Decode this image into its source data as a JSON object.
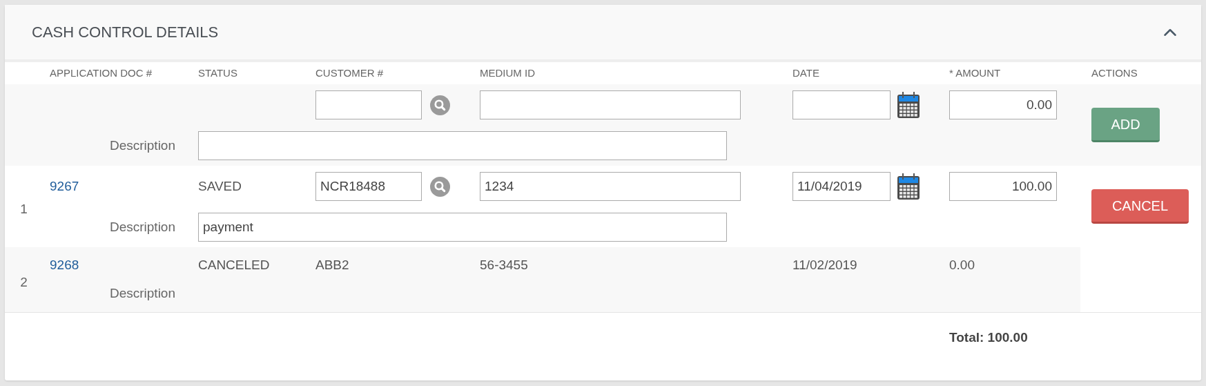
{
  "panel": {
    "title": "CASH CONTROL DETAILS",
    "expanded": true
  },
  "columns": [
    "APPLICATION DOC #",
    "STATUS",
    "CUSTOMER #",
    "MEDIUM ID",
    "DATE",
    "* AMOUNT",
    "ACTIONS"
  ],
  "rows": [
    {
      "kind": "new",
      "amount": "0.00",
      "description_label": "Description",
      "action": {
        "kind": "add",
        "label": "ADD"
      }
    },
    {
      "kind": "edit",
      "number": "1",
      "doc": "9267",
      "status": "SAVED",
      "customer": "NCR18488",
      "medium_id": "1234",
      "date": "11/04/2019",
      "amount": "100.00",
      "description_label": "Description",
      "description": "payment",
      "action": {
        "kind": "cancel",
        "label": "CANCEL"
      }
    },
    {
      "kind": "view",
      "number": "2",
      "doc": "9268",
      "status": "CANCELED",
      "customer": "ABB2",
      "medium_id": "56-3455",
      "date": "11/02/2019",
      "amount": "0.00",
      "description_label": "Description"
    }
  ],
  "total": "Total: 100.00"
}
